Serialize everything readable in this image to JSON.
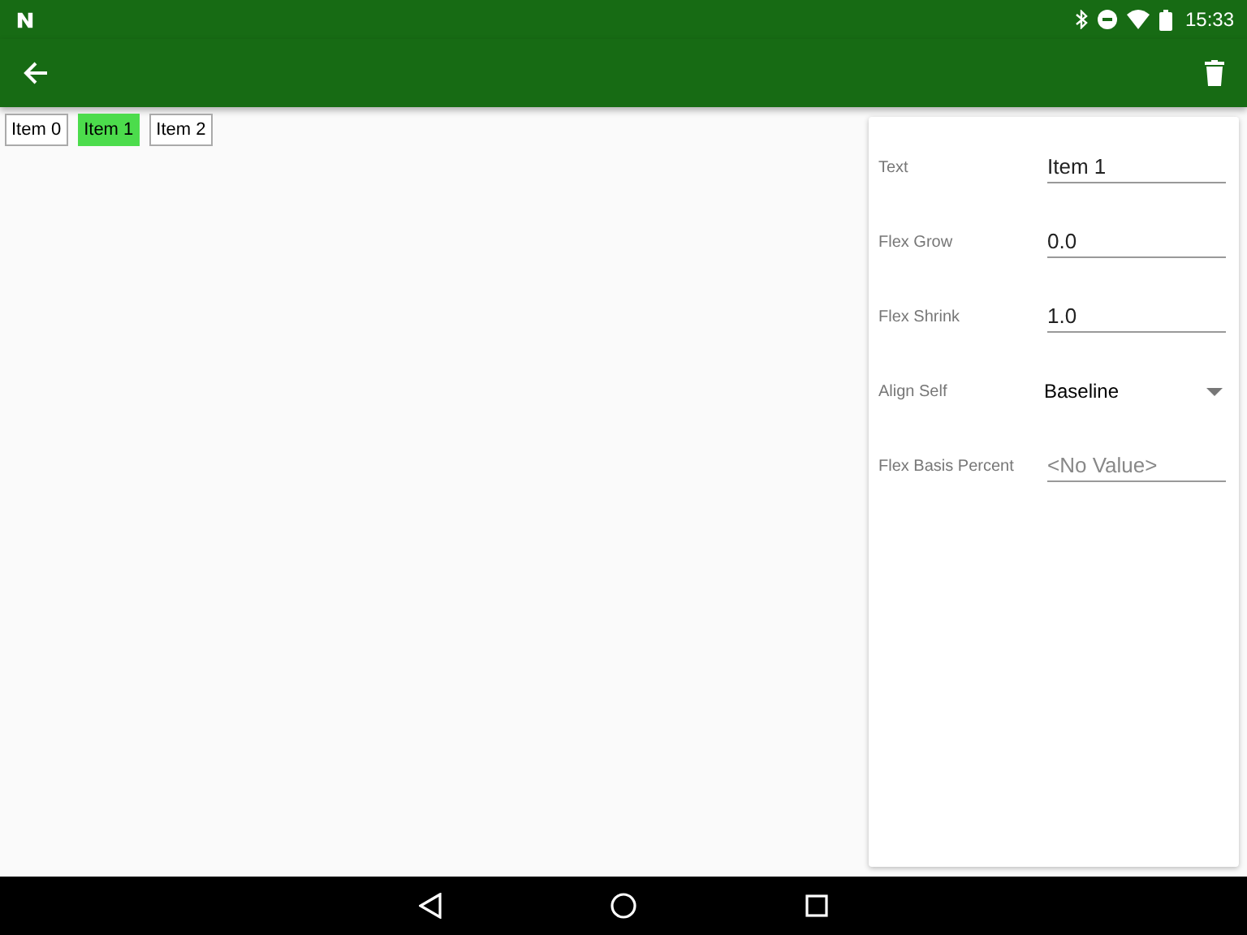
{
  "status_bar": {
    "time": "15:33"
  },
  "items": [
    {
      "label": "Item 0",
      "selected": false
    },
    {
      "label": "Item 1",
      "selected": true
    },
    {
      "label": "Item 2",
      "selected": false
    }
  ],
  "properties": [
    {
      "kind": "text",
      "label": "Text",
      "value": "Item 1"
    },
    {
      "kind": "text",
      "label": "Flex Grow",
      "value": "0.0"
    },
    {
      "kind": "text",
      "label": "Flex Shrink",
      "value": "1.0"
    },
    {
      "kind": "dropdown",
      "label": "Align Self",
      "value": "Baseline"
    },
    {
      "kind": "text",
      "label": "Flex Basis Percent",
      "placeholder": "<No Value>"
    }
  ]
}
